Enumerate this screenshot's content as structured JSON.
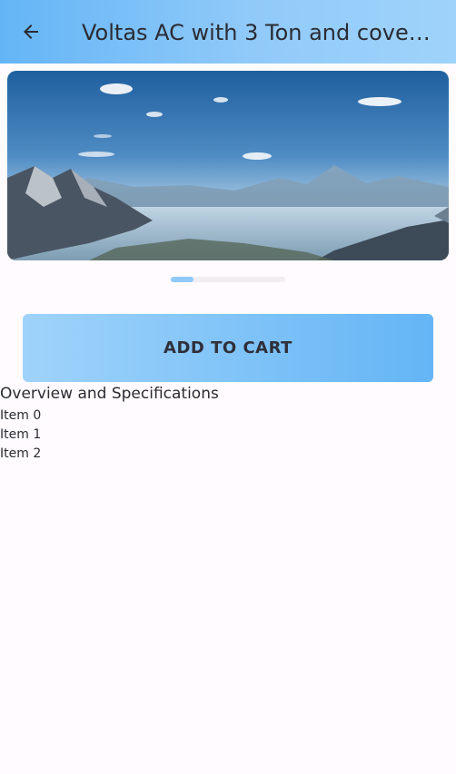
{
  "app_bar": {
    "title": "Voltas AC with 3 Ton and cover o…",
    "back_icon": "arrow-left-icon",
    "gradient": [
      "#64b5f6",
      "#9fd3fb"
    ]
  },
  "carousel": {
    "image_name": "mountain-landscape-photo",
    "current_slide": 0,
    "indicator_progress": 0.2
  },
  "actions": {
    "add_to_cart_label": "ADD TO CART"
  },
  "details": {
    "section_title": "Overview and Specifications",
    "items": [
      "Item 0",
      "Item 1",
      "Item 2"
    ]
  },
  "colors": {
    "accent": "#90caf9",
    "background": "#fffbfe"
  }
}
